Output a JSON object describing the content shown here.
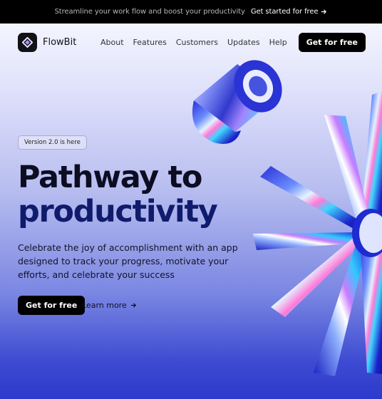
{
  "announcement": {
    "text": "Streamline your work flow and boost your productivity",
    "cta": "Get started for free",
    "cta_icon": "arrow-right-icon"
  },
  "nav": {
    "brand": "FlowBit",
    "links": [
      "About",
      "Features",
      "Customers",
      "Updates",
      "Help"
    ],
    "cta": "Get for free"
  },
  "hero": {
    "badge": "Version 2.0 is here",
    "title_line1": "Pathway to",
    "title_line2": "productivity",
    "description": "Celebrate the joy of accomplishment with an app designed to track your progress, motivate your efforts, and celebrate your success",
    "primary_cta": "Get for free",
    "secondary_cta": "Learn more",
    "secondary_icon": "arrow-right-icon"
  },
  "colors": {
    "announcement_bg": "#000000",
    "primary_button": "#000000",
    "title_dark": "#0c0d22",
    "title_blue": "#0f1b6b",
    "gradient_bottom": "#2d39cc"
  }
}
